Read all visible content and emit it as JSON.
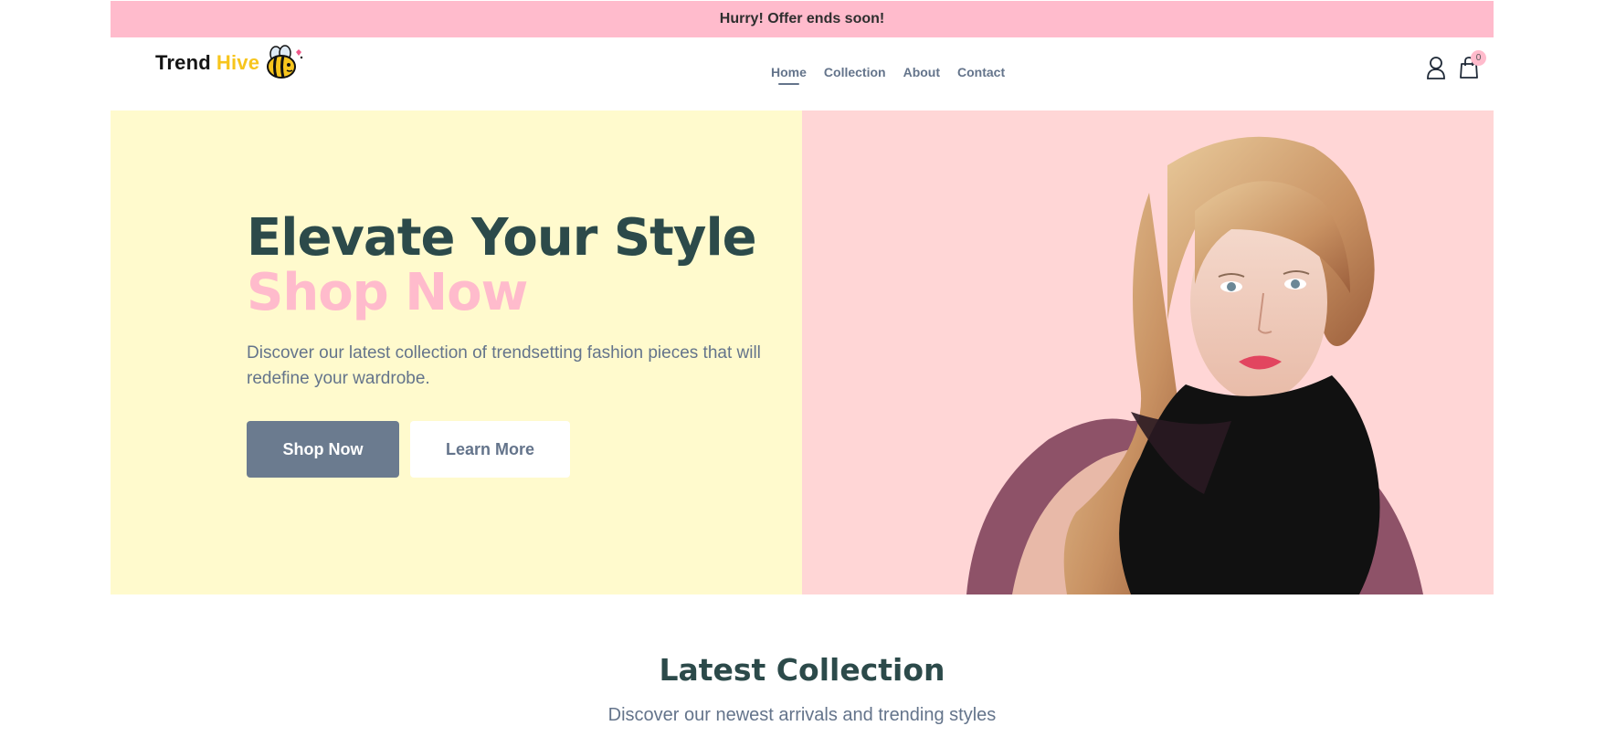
{
  "promo": {
    "text": "Hurry! Offer ends soon!"
  },
  "brand": {
    "name_part1": "Trend",
    "name_part2": "Hive",
    "mascot": "bee-icon"
  },
  "nav": {
    "items": [
      {
        "label": "Home",
        "active": true
      },
      {
        "label": "Collection",
        "active": false
      },
      {
        "label": "About",
        "active": false
      },
      {
        "label": "Contact",
        "active": false
      }
    ]
  },
  "header_actions": {
    "user_icon": "user-icon",
    "cart_icon": "shopping-bag-icon",
    "cart_count": "0"
  },
  "hero": {
    "title": "Elevate Your Style",
    "title_accent": "Shop Now",
    "description": "Discover our latest collection of trendsetting fashion pieces that will redefine your wardrobe.",
    "primary_button": "Shop Now",
    "secondary_button": "Learn More",
    "image": "model-portrait-image"
  },
  "latest": {
    "title": "Latest Collection",
    "subtitle": "Discover our newest arrivals and trending styles"
  },
  "colors": {
    "promo_bg": "#ffbbcc",
    "hero_left_bg": "#fffacd",
    "hero_right_bg": "#ffd6d6",
    "heading": "#2c4a4a",
    "accent_pink": "#ffbbcc",
    "muted": "#64748b",
    "brand_yellow": "#f7c51d"
  }
}
